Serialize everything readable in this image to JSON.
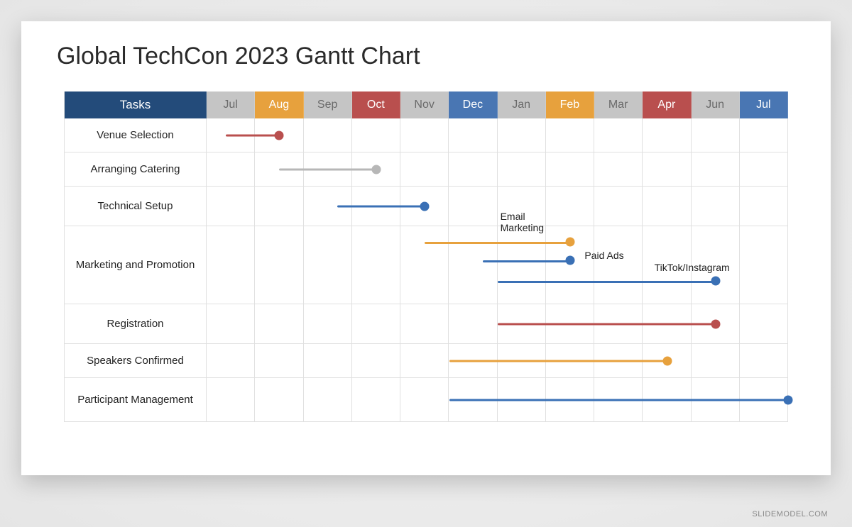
{
  "title": "Global TechCon 2023 Gantt Chart",
  "watermark": "SLIDEMODEL.COM",
  "header": {
    "tasks_label": "Tasks",
    "months": [
      {
        "label": "Jul",
        "color": "grey"
      },
      {
        "label": "Aug",
        "color": "orange"
      },
      {
        "label": "Sep",
        "color": "grey"
      },
      {
        "label": "Oct",
        "color": "red"
      },
      {
        "label": "Nov",
        "color": "grey"
      },
      {
        "label": "Dec",
        "color": "blue"
      },
      {
        "label": "Jan",
        "color": "grey"
      },
      {
        "label": "Feb",
        "color": "orange"
      },
      {
        "label": "Mar",
        "color": "grey"
      },
      {
        "label": "Apr",
        "color": "red"
      },
      {
        "label": "Jun",
        "color": "grey"
      },
      {
        "label": "Jul",
        "color": "blue"
      }
    ]
  },
  "annotations": {
    "email_marketing": "Email\nMarketing",
    "paid_ads": "Paid Ads",
    "tiktok_instagram": "TikTok/Instagram"
  },
  "colors": {
    "line_red": "#b94f4e",
    "line_grey": "#b7b7b7",
    "line_blue": "#3a70b5",
    "line_orange": "#e7a13d"
  },
  "chart_data": {
    "type": "bar",
    "orientation": "gantt",
    "timeline": [
      "Jul",
      "Aug",
      "Sep",
      "Oct",
      "Nov",
      "Dec",
      "Jan",
      "Feb",
      "Mar",
      "Apr",
      "Jun",
      "Jul"
    ],
    "tasks": [
      {
        "name": "Venue Selection",
        "bars": [
          {
            "start": 0.4,
            "end": 1.5,
            "color": "#b94f4e"
          }
        ]
      },
      {
        "name": "Arranging Catering",
        "bars": [
          {
            "start": 1.5,
            "end": 3.5,
            "color": "#b7b7b7"
          }
        ]
      },
      {
        "name": "Technical Setup",
        "bars": [
          {
            "start": 2.7,
            "end": 4.5,
            "color": "#3a70b5"
          }
        ]
      },
      {
        "name": "Marketing and Promotion",
        "bars": [
          {
            "start": 4.5,
            "end": 7.5,
            "color": "#e7a13d",
            "label": "Email Marketing"
          },
          {
            "start": 5.7,
            "end": 7.5,
            "color": "#3a70b5",
            "label": "Paid Ads"
          },
          {
            "start": 6.0,
            "end": 10.5,
            "color": "#3a70b5",
            "label": "TikTok/Instagram"
          }
        ]
      },
      {
        "name": "Registration",
        "bars": [
          {
            "start": 6.0,
            "end": 10.5,
            "color": "#b94f4e"
          }
        ]
      },
      {
        "name": "Speakers Confirmed",
        "bars": [
          {
            "start": 5.0,
            "end": 9.5,
            "color": "#e7a13d"
          }
        ]
      },
      {
        "name": "Participant Management",
        "bars": [
          {
            "start": 5.0,
            "end": 12.0,
            "color": "#3a70b5"
          }
        ]
      }
    ]
  },
  "tasks": {
    "r0": "Venue Selection",
    "r1": "Arranging Catering",
    "r2": "Technical Setup",
    "r3": "Marketing and Promotion",
    "r4": "Registration",
    "r5": "Speakers Confirmed",
    "r6": "Participant Management"
  }
}
